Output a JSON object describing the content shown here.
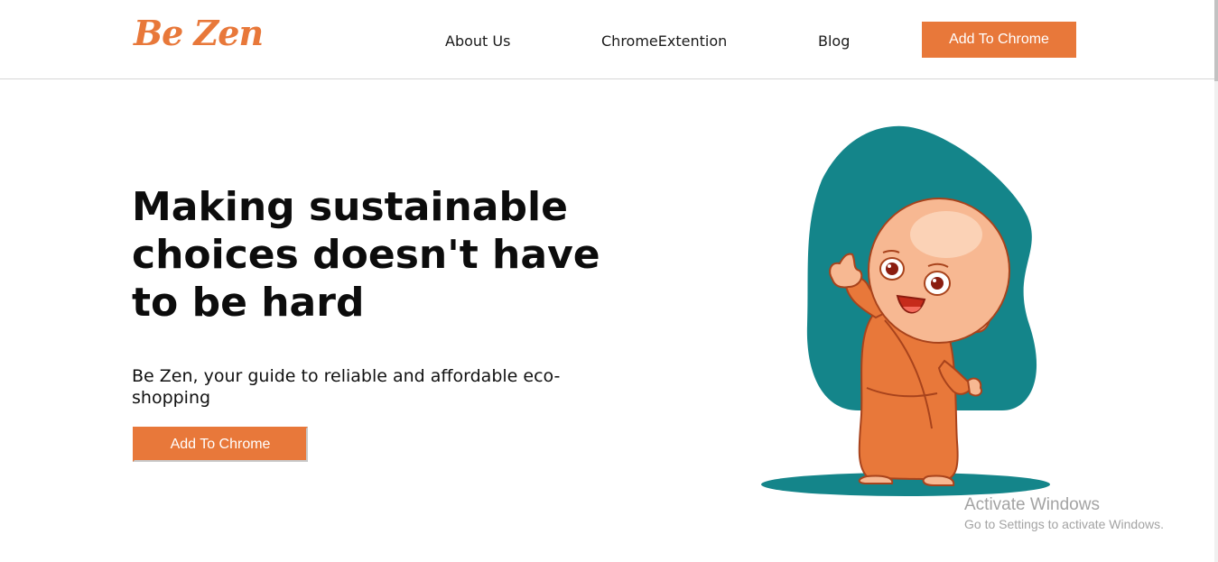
{
  "header": {
    "logo": "Be Zen",
    "nav": [
      {
        "label": "About Us"
      },
      {
        "label": "ChromeExtention"
      },
      {
        "label": "Blog"
      }
    ],
    "cta_label": "Add To Chrome"
  },
  "hero": {
    "title": "Making sustainable choices doesn't have to be hard",
    "subtitle": "Be Zen, your guide to reliable and affordable eco-shopping",
    "cta_label": "Add To Chrome",
    "illustration_icon": "monk-thumbs-up-illustration"
  },
  "watermark": {
    "title": "Activate Windows",
    "subtitle": "Go to Settings to activate Windows."
  },
  "colors": {
    "accent": "#e8783a",
    "teal": "#14858a",
    "text": "#0c0c0c"
  }
}
